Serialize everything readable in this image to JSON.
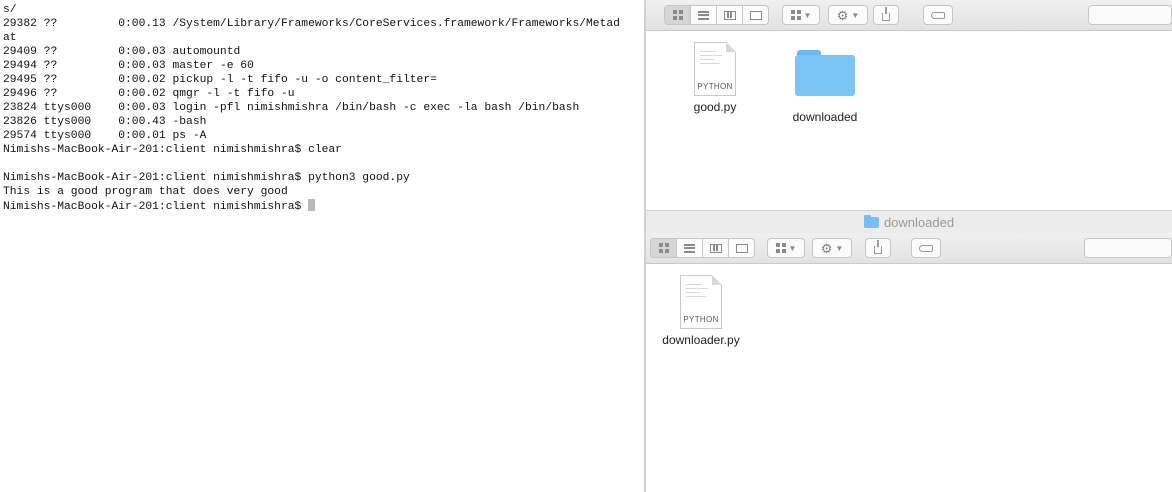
{
  "terminal": {
    "lines": [
      "s/",
      "29382 ??         0:00.13 /System/Library/Frameworks/CoreServices.framework/Frameworks/Metad",
      "at",
      "29409 ??         0:00.03 automountd",
      "29494 ??         0:00.03 master -e 60",
      "29495 ??         0:00.02 pickup -l -t fifo -u -o content_filter=",
      "29496 ??         0:00.02 qmgr -l -t fifo -u",
      "23824 ttys000    0:00.03 login -pfl nimishmishra /bin/bash -c exec -la bash /bin/bash",
      "23826 ttys000    0:00.43 -bash",
      "29574 ttys000    0:00.01 ps -A",
      "Nimishs-MacBook-Air-201:client nimishmishra$ clear",
      "",
      "Nimishs-MacBook-Air-201:client nimishmishra$ python3 good.py",
      "This is a good program that does very good",
      "Nimishs-MacBook-Air-201:client nimishmishra$ "
    ]
  },
  "finder_top": {
    "items": [
      {
        "name": "good.py",
        "type_label": "PYTHON",
        "icon": "python-file-icon"
      },
      {
        "name": "downloaded",
        "icon": "folder-icon"
      }
    ]
  },
  "finder_bottom": {
    "title": "downloaded",
    "items": [
      {
        "name": "downloader.py",
        "type_label": "PYTHON",
        "icon": "python-file-icon"
      }
    ]
  },
  "colors": {
    "folder": "#7ac4f6",
    "toolbar": "#e6e6e6"
  }
}
